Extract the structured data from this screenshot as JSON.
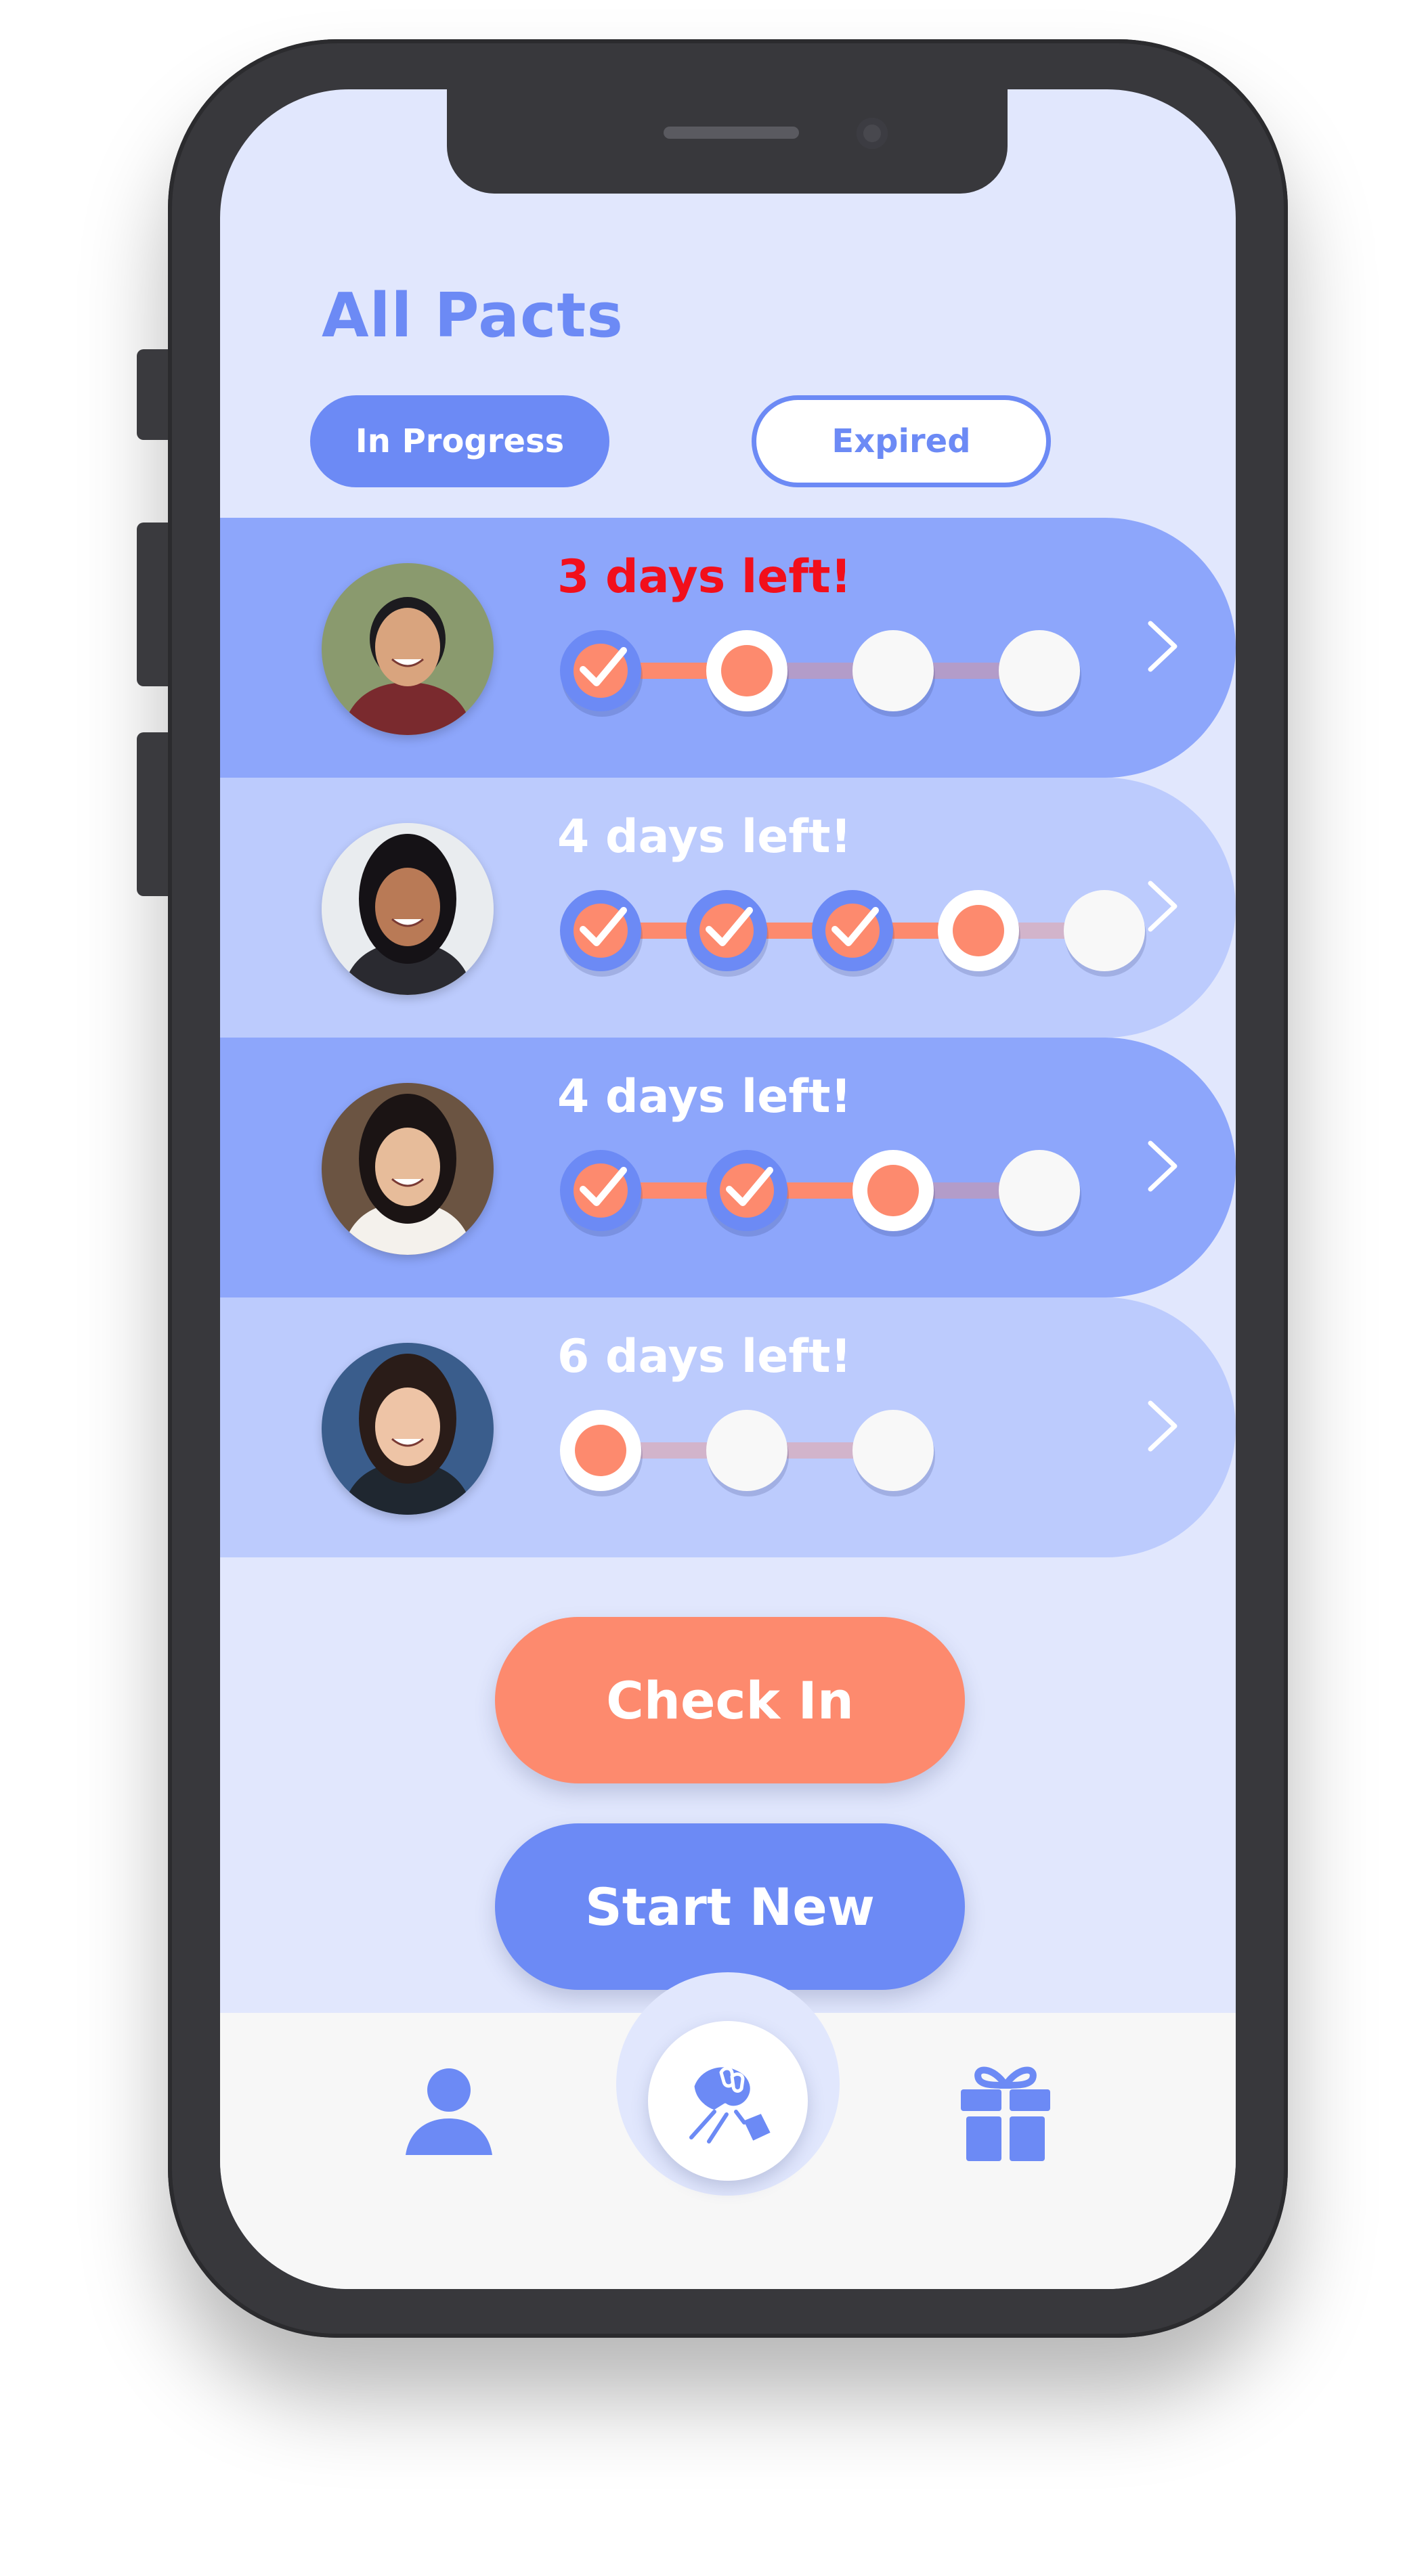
{
  "colors": {
    "accent": "#6c8af5",
    "row_dark": "#8da6fb",
    "row_light": "#bccbfd",
    "screen_bg": "#e1e7fd",
    "orange": "#fd8a6e",
    "urgent_red": "#f20f1b",
    "white": "#ffffff"
  },
  "header": {
    "title": "All Pacts"
  },
  "tabs": [
    {
      "label": "In Progress",
      "active": true
    },
    {
      "label": "Expired",
      "active": false
    }
  ],
  "pacts": [
    {
      "days_left": "3 days left!",
      "urgent": true,
      "avatar": "person-photo",
      "progress": [
        "done",
        "current",
        "todo",
        "todo"
      ]
    },
    {
      "days_left": "4 days left!",
      "urgent": false,
      "avatar": "person-photo",
      "progress": [
        "done",
        "done",
        "done",
        "current",
        "todo"
      ]
    },
    {
      "days_left": "4 days left!",
      "urgent": false,
      "avatar": "person-photo",
      "progress": [
        "done",
        "done",
        "current",
        "todo"
      ]
    },
    {
      "days_left": "6 days left!",
      "urgent": false,
      "avatar": "person-photo",
      "progress": [
        "current",
        "todo",
        "todo"
      ]
    }
  ],
  "actions": {
    "check_in": "Check In",
    "start_new": "Start New"
  },
  "nav": {
    "left_icon": "person-icon",
    "center_icon": "handshake-icon",
    "right_icon": "gift-icon"
  }
}
